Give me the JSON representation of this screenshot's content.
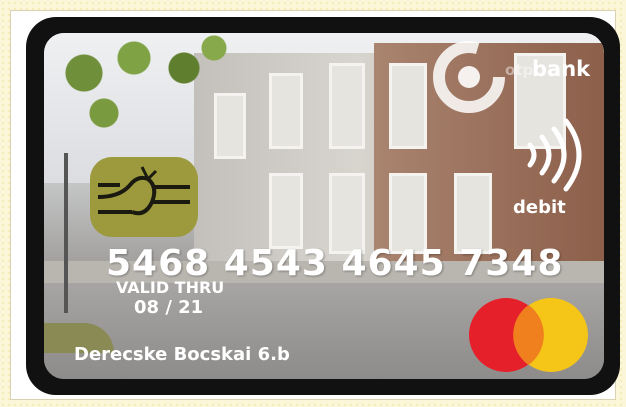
{
  "card": {
    "bank_name": "bank",
    "bank_prefix": "otp",
    "type_label": "debit",
    "number": "5468 4543 4645 7348",
    "valid_label": "VALID THRU",
    "valid_date": "08 / 21",
    "holder": "Derecske Bocskai 6.b"
  },
  "colors": {
    "frame_black": "#111111",
    "chip": "#9c9a3c",
    "mastercard_red": "#e5202a",
    "mastercard_yellow": "#f5c518",
    "mastercard_orange": "#f07f1e"
  },
  "icons": {
    "chip": "chip-icon",
    "bank_logo": "otp-logo-icon",
    "contactless": "contactless-icon",
    "mastercard": "mastercard-logo-icon"
  }
}
